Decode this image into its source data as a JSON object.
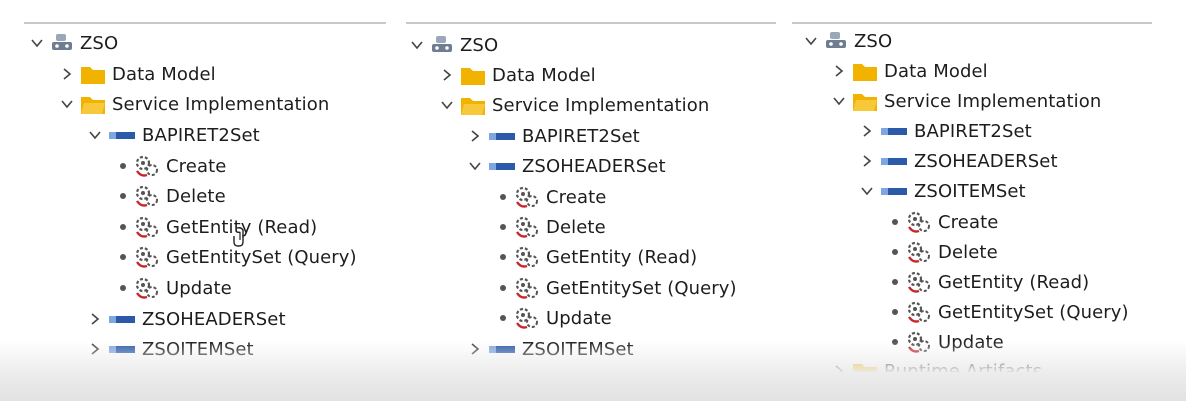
{
  "panels": [
    {
      "root": "ZSO",
      "data_model": "Data Model",
      "service_impl": "Service Implementation",
      "sets": [
        "BAPIRET2Set",
        "ZSOHEADERSet",
        "ZSOITEMSet"
      ],
      "ops": [
        "Create",
        "Delete",
        "GetEntity (Read)",
        "GetEntitySet (Query)",
        "Update"
      ]
    },
    {
      "root": "ZSO",
      "data_model": "Data Model",
      "service_impl": "Service Implementation",
      "sets": [
        "BAPIRET2Set",
        "ZSOHEADERSet",
        "ZSOITEMSet"
      ],
      "ops": [
        "Create",
        "Delete",
        "GetEntity (Read)",
        "GetEntitySet (Query)",
        "Update"
      ]
    },
    {
      "root": "ZSO",
      "data_model": "Data Model",
      "service_impl": "Service Implementation",
      "sets": [
        "BAPIRET2Set",
        "ZSOHEADERSet",
        "ZSOITEMSet"
      ],
      "ops": [
        "Create",
        "Delete",
        "GetEntity (Read)",
        "GetEntitySet (Query)",
        "Update"
      ],
      "partial_item": "Runtime Artifacts"
    }
  ],
  "colors": {
    "folder": "#f2b200",
    "entity_set": "#2a5aa8",
    "op_icon": "#c62828",
    "text": "#1d1d1d"
  },
  "icons": {
    "root": "service-node-icon",
    "folder": "folder-icon",
    "entity_set": "entity-set-icon",
    "operation": "gear-operation-icon"
  }
}
